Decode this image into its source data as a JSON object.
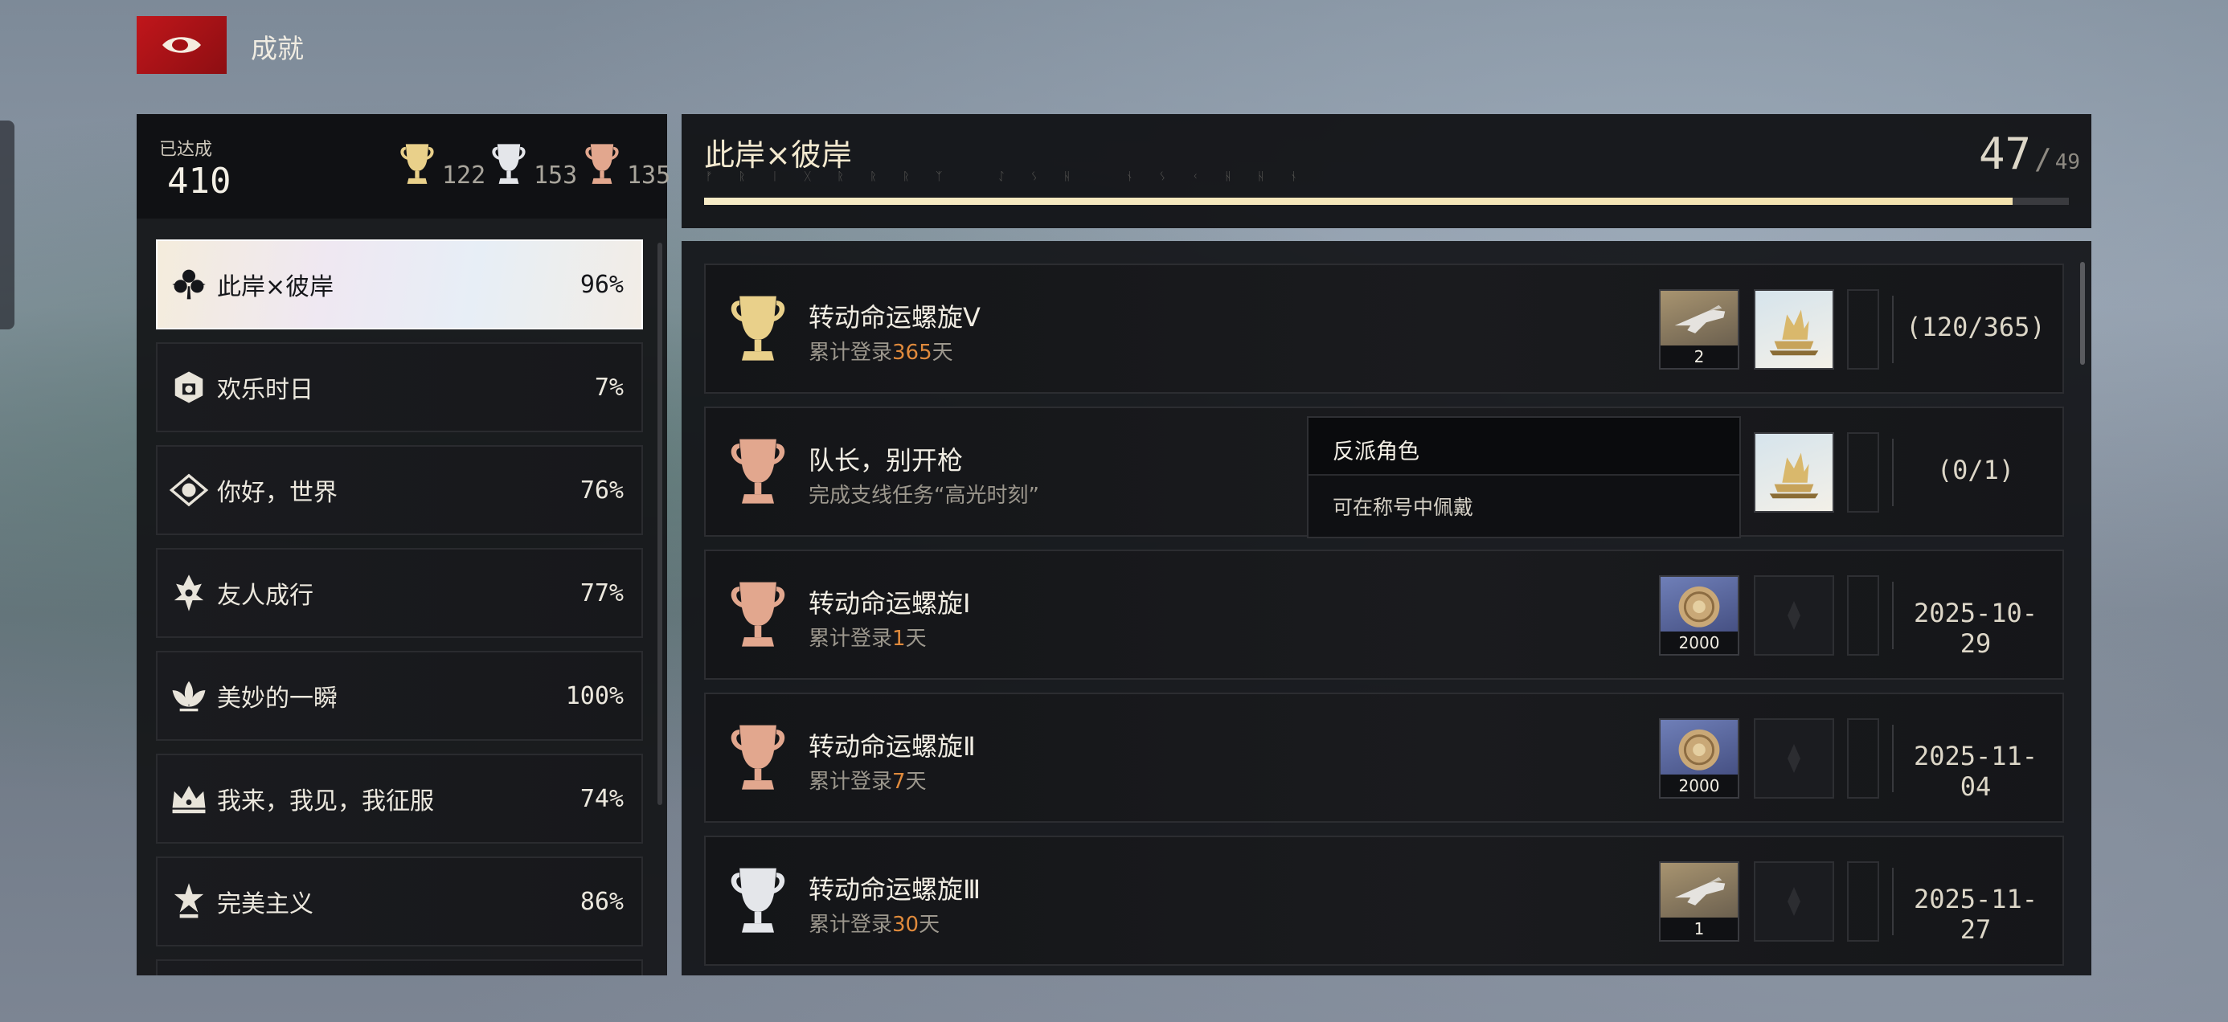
{
  "header": {
    "title": "成就"
  },
  "summary": {
    "achieved_label": "已达成",
    "achieved_count": "410",
    "gold_count": "122",
    "silver_count": "153",
    "bronze_count": "135"
  },
  "categories": [
    {
      "label": "此岸×彼岸",
      "percent": "96%",
      "active": true,
      "icon": "clover-emblem-icon"
    },
    {
      "label": "欢乐时日",
      "percent": "7%",
      "icon": "cube-emblem-icon"
    },
    {
      "label": "你好，世界",
      "percent": "76%",
      "icon": "eye-emblem-icon"
    },
    {
      "label": "友人成行",
      "percent": "77%",
      "icon": "flame-emblem-icon"
    },
    {
      "label": "美妙的一瞬",
      "percent": "100%",
      "icon": "lotus-emblem-icon"
    },
    {
      "label": "我来，我见，我征服",
      "percent": "74%",
      "icon": "crown-emblem-icon"
    },
    {
      "label": "完美主义",
      "percent": "86%",
      "icon": "star-emblem-icon"
    }
  ],
  "detail": {
    "title": "此岸×彼岸",
    "progress_current": "47",
    "progress_total": "49",
    "progress_fraction": 0.959
  },
  "achievements": [
    {
      "title": "转动命运螺旋Ⅴ",
      "desc_prefix": "累计登录",
      "desc_highlight": "365",
      "desc_suffix": "天",
      "trophy": "gold",
      "reward1_qty": "2",
      "status": "(120/365)"
    },
    {
      "title": "队长，别开枪",
      "desc_prefix": "完成支线任务“高光时刻”",
      "desc_highlight": "",
      "desc_suffix": "",
      "trophy": "bronze",
      "status": "(0/1)"
    },
    {
      "title": "转动命运螺旋Ⅰ",
      "desc_prefix": "累计登录",
      "desc_highlight": "1",
      "desc_suffix": "天",
      "trophy": "bronze",
      "reward1_qty": "2000",
      "status": "2025-10-29"
    },
    {
      "title": "转动命运螺旋Ⅱ",
      "desc_prefix": "累计登录",
      "desc_highlight": "7",
      "desc_suffix": "天",
      "trophy": "bronze",
      "reward1_qty": "2000",
      "status": "2025-11-04"
    },
    {
      "title": "转动命运螺旋Ⅲ",
      "desc_prefix": "累计登录",
      "desc_highlight": "30",
      "desc_suffix": "天",
      "trophy": "silver",
      "reward1_qty": "1",
      "status": "2025-11-27"
    }
  ],
  "tooltip": {
    "title": "反派角色",
    "desc": "可在称号中佩戴"
  },
  "colors": {
    "gold": "#e9d08a",
    "silver": "#e4e6ea",
    "bronze": "#e2a78e",
    "highlight": "#e08a3c",
    "accent_red": "#c0161b"
  }
}
